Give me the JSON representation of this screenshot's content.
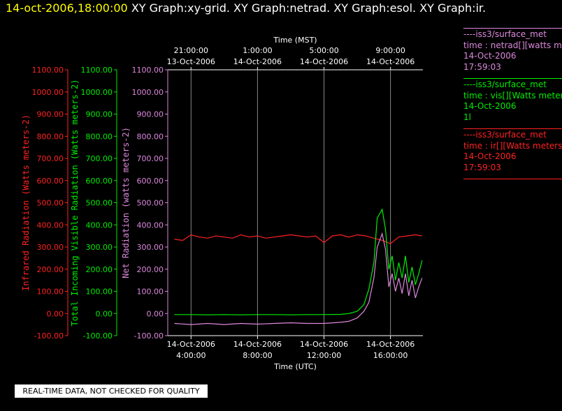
{
  "header": {
    "timestamp": "14-oct-2006,18:00:00",
    "graphs": "XY Graph:xy-grid.  XY Graph:netrad.  XY Graph:esol.  XY Graph:ir."
  },
  "legend": [
    {
      "lines": [
        "----iss3/surface_met",
        "time : netrad[][watts me",
        "14-Oct-2006",
        "17:59:03"
      ],
      "color": "#dd88dd"
    },
    {
      "lines": [
        "----iss3/surface_met",
        "time : vis[][Watts meter",
        "14-Oct-2006",
        "1l"
      ],
      "color": "#00ee00"
    },
    {
      "lines": [
        "----iss3/surface_met",
        "time : ir[][Watts meters",
        "14-Oct-2006",
        "17:59:03"
      ],
      "color": "#ff2222"
    }
  ],
  "quality_note": "REAL-TIME DATA, NOT CHECKED FOR QUALITY",
  "chart_data": {
    "type": "line",
    "title": "",
    "top_axis": {
      "label": "Time (MST)",
      "ticks": [
        {
          "time": "21:00:00",
          "date": "13-Oct-2006",
          "utc_hour": 4
        },
        {
          "time": "1:00:00",
          "date": "14-Oct-2006",
          "utc_hour": 8
        },
        {
          "time": "5:00:00",
          "date": "14-Oct-2006",
          "utc_hour": 12
        },
        {
          "time": "9:00:00",
          "date": "14-Oct-2006",
          "utc_hour": 16
        }
      ]
    },
    "bottom_axis": {
      "label": "Time (UTC)",
      "range_utc_hours": [
        2.6,
        17.95
      ],
      "ticks": [
        {
          "date": "14-Oct-2006",
          "time": "4:00:00",
          "utc_hour": 4
        },
        {
          "date": "14-Oct-2006",
          "time": "8:00:00",
          "utc_hour": 8
        },
        {
          "date": "14-Oct-2006",
          "time": "12:00:00",
          "utc_hour": 12
        },
        {
          "date": "14-Oct-2006",
          "time": "16:00:00",
          "utc_hour": 16
        }
      ]
    },
    "y_axes": [
      {
        "id": "ir",
        "label": "Infrared Radiation (Watts meters-2)",
        "color": "#ff2222",
        "ylim": [
          -100,
          1100
        ]
      },
      {
        "id": "vis",
        "label": "Total Incoming Visible Radiation (Watts meters-2)",
        "color": "#00ee00",
        "ylim": [
          -100,
          1100
        ]
      },
      {
        "id": "netrad",
        "label": "Net Radiation (watts meters-2)",
        "color": "#dd88dd",
        "ylim": [
          -100,
          1100
        ]
      }
    ],
    "y_ticks": [
      "-100.00",
      "0.00",
      "100.00",
      "200.00",
      "300.00",
      "400.00",
      "500.00",
      "600.00",
      "700.00",
      "800.00",
      "900.00",
      "1000.00",
      "1100.00"
    ],
    "grid": "vertical lines at major x ticks",
    "series": [
      {
        "name": "time : ir[][Watts meters",
        "axis": "ir",
        "color": "#ff2222",
        "x": [
          3.0,
          3.5,
          4.0,
          4.5,
          5.0,
          5.5,
          6.0,
          6.5,
          7.0,
          7.5,
          8.0,
          8.5,
          9.0,
          9.5,
          10.0,
          10.5,
          11.0,
          11.5,
          12.0,
          12.5,
          13.0,
          13.5,
          14.0,
          14.5,
          15.0,
          15.5,
          16.0,
          16.5,
          17.0,
          17.5,
          17.9
        ],
        "y": [
          335,
          330,
          355,
          345,
          340,
          350,
          345,
          340,
          355,
          345,
          350,
          340,
          345,
          350,
          355,
          350,
          345,
          350,
          320,
          350,
          355,
          345,
          355,
          350,
          340,
          330,
          315,
          345,
          350,
          355,
          350
        ]
      },
      {
        "name": "time : vis[][Watts meter",
        "axis": "vis",
        "color": "#00ee00",
        "x": [
          3.0,
          4.0,
          5.0,
          6.0,
          7.0,
          8.0,
          9.0,
          10.0,
          11.0,
          12.0,
          13.0,
          13.5,
          14.0,
          14.4,
          14.7,
          15.0,
          15.2,
          15.5,
          15.7,
          15.9,
          16.1,
          16.3,
          16.5,
          16.7,
          16.9,
          17.1,
          17.3,
          17.5,
          17.7,
          17.9
        ],
        "y": [
          -5,
          -5,
          -6,
          -5,
          -6,
          -5,
          -5,
          -6,
          -5,
          -5,
          -4,
          0,
          10,
          40,
          110,
          230,
          430,
          470,
          380,
          200,
          260,
          150,
          230,
          160,
          260,
          140,
          210,
          130,
          180,
          240
        ]
      },
      {
        "name": "time : netrad[][watts me",
        "axis": "netrad",
        "color": "#dd88dd",
        "x": [
          3.0,
          4.0,
          5.0,
          6.0,
          7.0,
          8.0,
          9.0,
          10.0,
          11.0,
          12.0,
          13.0,
          13.5,
          14.0,
          14.4,
          14.7,
          15.0,
          15.2,
          15.5,
          15.7,
          15.9,
          16.1,
          16.3,
          16.5,
          16.7,
          16.9,
          17.1,
          17.3,
          17.5,
          17.7,
          17.9
        ],
        "y": [
          -45,
          -50,
          -45,
          -50,
          -45,
          -48,
          -45,
          -42,
          -45,
          -45,
          -40,
          -35,
          -20,
          10,
          50,
          160,
          300,
          360,
          290,
          120,
          180,
          100,
          160,
          90,
          180,
          80,
          150,
          70,
          120,
          160
        ]
      }
    ]
  }
}
